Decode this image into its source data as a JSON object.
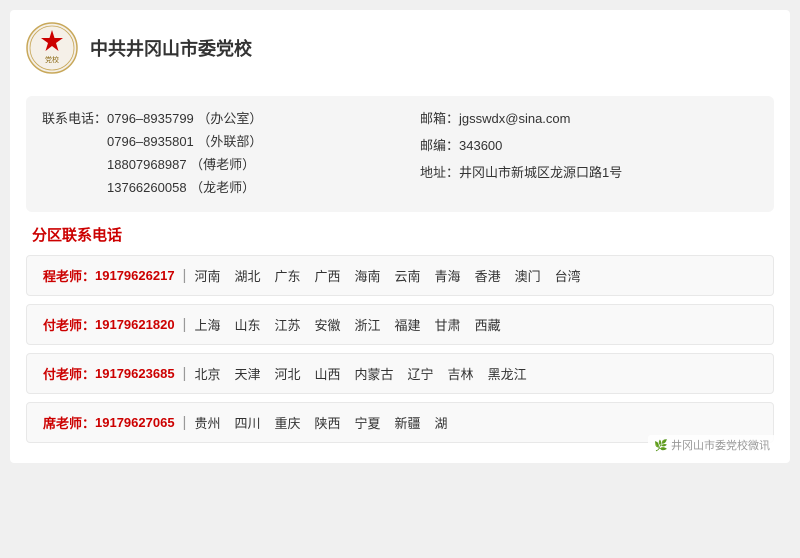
{
  "org": {
    "name": "中共井冈山市委党校"
  },
  "contact_info": {
    "phone_label": "联系电话：",
    "phones": [
      {
        "number": "0796–8935799",
        "note": "（办公室）"
      },
      {
        "number": "0796–8935801",
        "note": "（外联部）"
      },
      {
        "number": "18807968987",
        "note": "（傅老师）"
      },
      {
        "number": "13766260058",
        "note": "（龙老师）"
      }
    ],
    "email_label": "邮箱：",
    "email": "jgsswdx@sina.com",
    "postal_label": "邮编：",
    "postal": "343600",
    "address_label": "地址：",
    "address": "井冈山市新城区龙源口路1号"
  },
  "section_title": "分区联系电话",
  "contacts": [
    {
      "person": "程老师：",
      "phone": "19179626217",
      "regions": [
        "河南",
        "湖北",
        "广东",
        "广西",
        "海南",
        "云南",
        "青海",
        "香港",
        "澳门",
        "台湾"
      ]
    },
    {
      "person": "付老师：",
      "phone": "19179621820",
      "regions": [
        "上海",
        "山东",
        "江苏",
        "安徽",
        "浙江",
        "福建",
        "甘肃",
        "西藏"
      ]
    },
    {
      "person": "付老师：",
      "phone": "19179623685",
      "regions": [
        "北京",
        "天津",
        "河北",
        "山西",
        "内蒙古",
        "辽宁",
        "吉林",
        "黑龙江"
      ]
    },
    {
      "person": "席老师：",
      "phone": "19179627065",
      "regions": [
        "贵州",
        "四川",
        "重庆",
        "陕西",
        "宁夏",
        "新疆",
        "湖"
      ]
    }
  ],
  "watermark": "井冈山市委党校微讯"
}
